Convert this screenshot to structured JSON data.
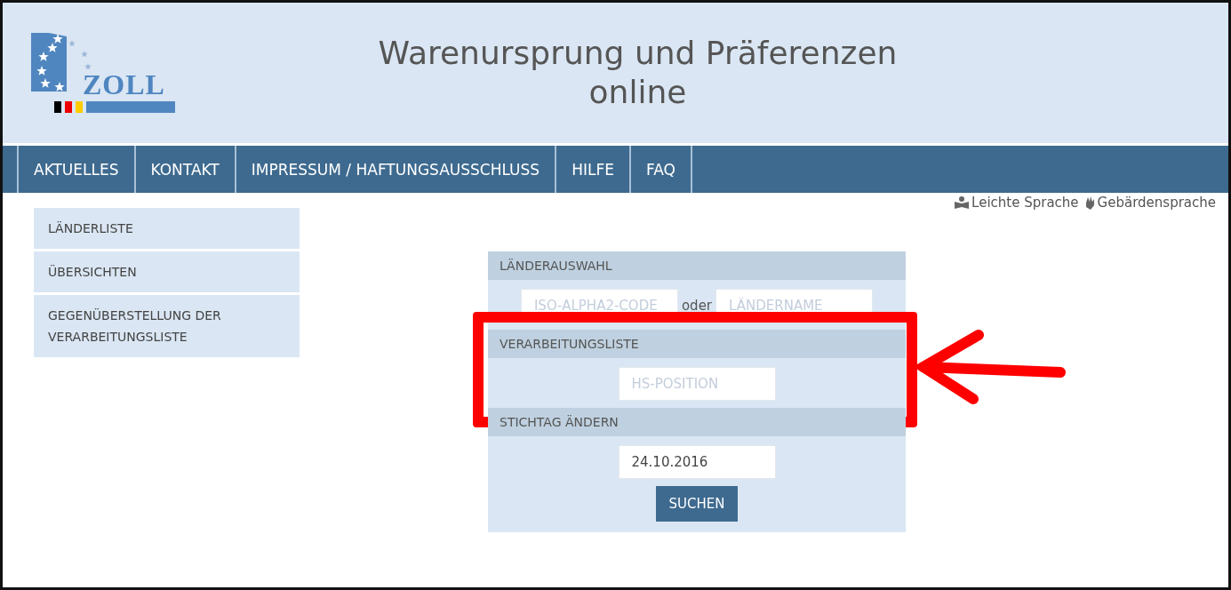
{
  "header": {
    "logo_text": "ZOLL",
    "title": "Warenursprung und Präferenzen online"
  },
  "nav": [
    {
      "label": "AKTUELLES",
      "selected": false
    },
    {
      "label": "KONTAKT",
      "selected": false
    },
    {
      "label": "IMPRESSUM / HAFTUNGSAUSSCHLUSS",
      "selected": false
    },
    {
      "label": "HILFE",
      "selected": false
    },
    {
      "label": "FAQ",
      "selected": false
    }
  ],
  "accessibility_links": [
    {
      "kind": "easy",
      "label": "Leichte Sprache"
    },
    {
      "kind": "sign",
      "label": "Gebärdensprache"
    }
  ],
  "sidebar": {
    "items": [
      {
        "label": "LÄNDERLISTE"
      },
      {
        "label": "ÜBERSICHTEN"
      },
      {
        "label": "GEGENÜBERSTELLUNG DER VERARBEITUNGSLISTE"
      }
    ]
  },
  "form": {
    "sections": [
      {
        "title": "LÄNDERAUSWAHL",
        "highlighted": false,
        "fields": [
          {
            "placeholder": "ISO-ALPHA2-CODE"
          },
          {
            "separator": "oder"
          },
          {
            "placeholder": "LÄNDERNAME"
          }
        ]
      },
      {
        "title": "VERARBEITUNGSLISTE",
        "highlighted": true,
        "fields": [
          {
            "placeholder": "HS-POSITION"
          }
        ]
      },
      {
        "title": "STICHTAG ÄNDERN",
        "highlighted": false,
        "fields": [
          {
            "value": "24.10.2016"
          }
        ]
      }
    ],
    "submit": "SUCHEN"
  }
}
